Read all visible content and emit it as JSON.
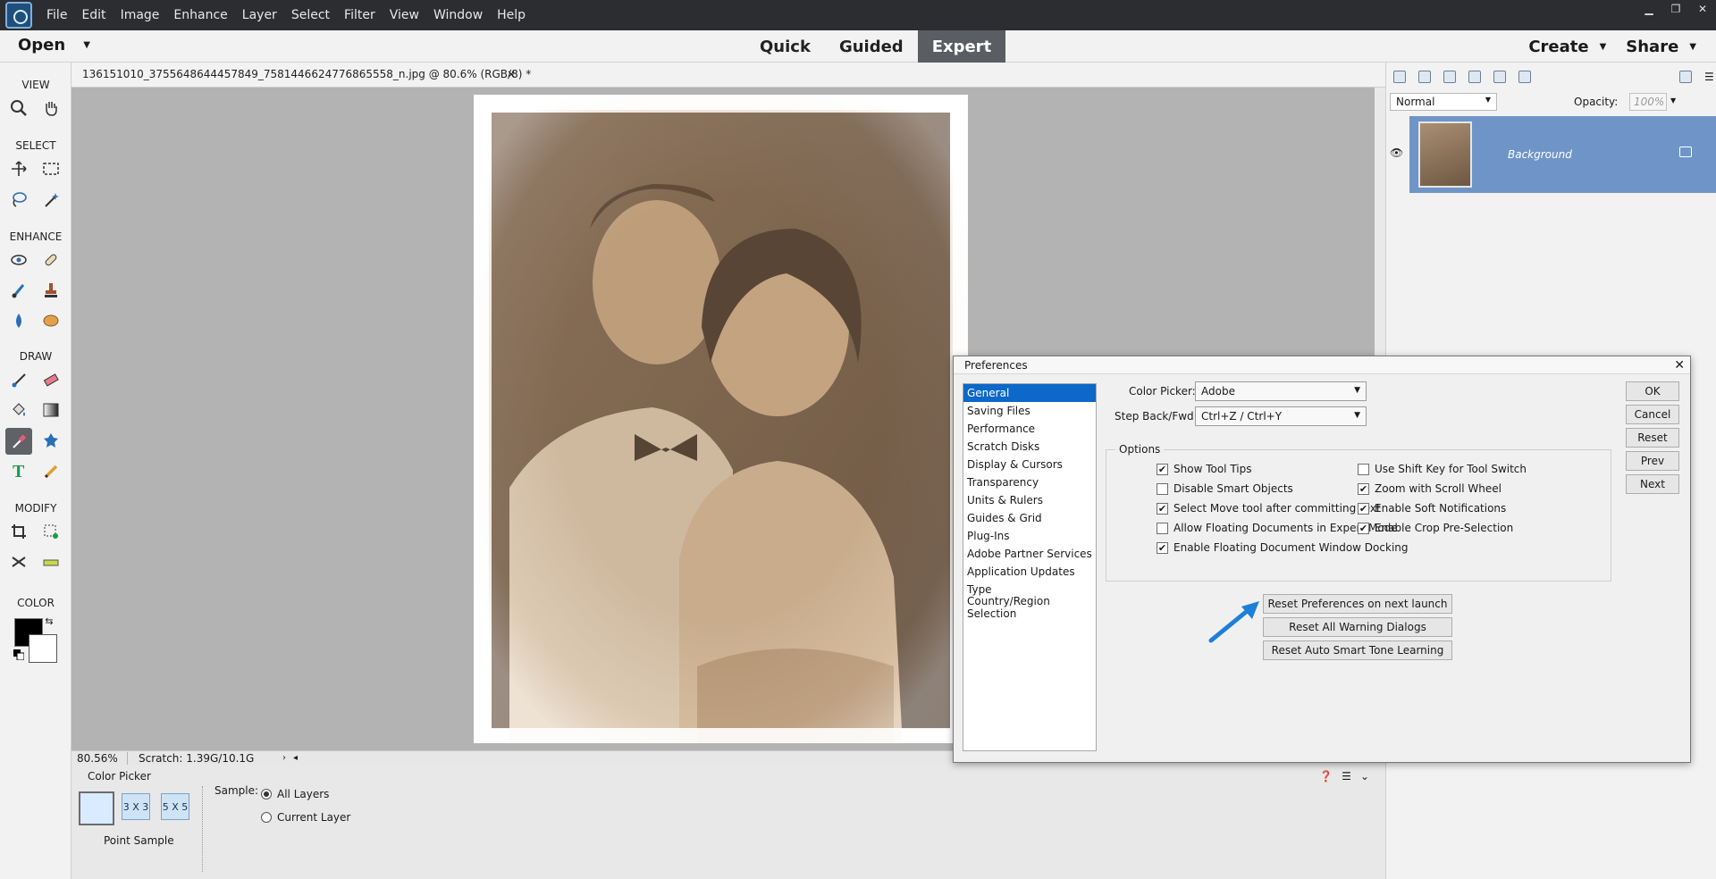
{
  "menubar": {
    "items": [
      "File",
      "Edit",
      "Image",
      "Enhance",
      "Layer",
      "Select",
      "Filter",
      "View",
      "Window",
      "Help"
    ],
    "window_controls": [
      "minimize-icon",
      "restore-icon",
      "close-icon"
    ]
  },
  "modebar": {
    "open_label": "Open",
    "modes": [
      "Quick",
      "Guided",
      "Expert"
    ],
    "active_mode": "Expert",
    "create_label": "Create",
    "share_label": "Share"
  },
  "toolbox": {
    "sections": [
      "VIEW",
      "SELECT",
      "ENHANCE",
      "DRAW",
      "MODIFY",
      "COLOR"
    ],
    "selected_tool": "color-picker-icon"
  },
  "document": {
    "tab_label": "136151010_3755648644457849_7581446624776865558_n.jpg @ 80.6% (RGB/8) *",
    "close_glyph": "×"
  },
  "status": {
    "zoom": "80.56%",
    "scratch": "Scratch: 1.39G/10.1G"
  },
  "tool_options": {
    "title": "Color Picker",
    "sizes": [
      "",
      "3 X 3",
      "5 X 5"
    ],
    "point_label": "Point Sample",
    "sample_label": "Sample:",
    "sample_options": [
      "All Layers",
      "Current Layer"
    ],
    "sample_selected": "All Layers"
  },
  "layers": {
    "blend_mode": "Normal",
    "opacity_label": "Opacity:",
    "opacity_value": "100%",
    "layer_name": "Background"
  },
  "dialog": {
    "title": "Preferences",
    "categories": [
      "General",
      "Saving Files",
      "Performance",
      "Scratch Disks",
      "Display & Cursors",
      "Transparency",
      "Units & Rulers",
      "Guides & Grid",
      "Plug-Ins",
      "Adobe Partner Services",
      "Application Updates",
      "Type",
      "Country/Region Selection"
    ],
    "selected_category": "General",
    "color_picker_label": "Color Picker:",
    "color_picker_value": "Adobe",
    "step_label": "Step Back/Fwd:",
    "step_value": "Ctrl+Z / Ctrl+Y",
    "options_legend": "Options",
    "options_left": [
      {
        "label": "Show Tool Tips",
        "checked": true
      },
      {
        "label": "Disable Smart Objects",
        "checked": false
      },
      {
        "label": "Select Move tool after committing text",
        "checked": true
      },
      {
        "label": "Allow Floating Documents in Expert Mode",
        "checked": false
      },
      {
        "label": "Enable Floating Document Window Docking",
        "checked": true
      }
    ],
    "options_right": [
      {
        "label": "Use Shift Key for Tool Switch",
        "checked": false
      },
      {
        "label": "Zoom with Scroll Wheel",
        "checked": true
      },
      {
        "label": "Enable Soft Notifications",
        "checked": true
      },
      {
        "label": "Enable Crop Pre-Selection",
        "checked": true
      }
    ],
    "reset_buttons": [
      "Reset Preferences on next launch",
      "Reset All Warning Dialogs",
      "Reset Auto Smart Tone Learning"
    ],
    "side_buttons": [
      "OK",
      "Cancel",
      "Reset",
      "Prev",
      "Next"
    ],
    "accent": "#0c68c9",
    "arrow_color": "#1e7fd8"
  }
}
